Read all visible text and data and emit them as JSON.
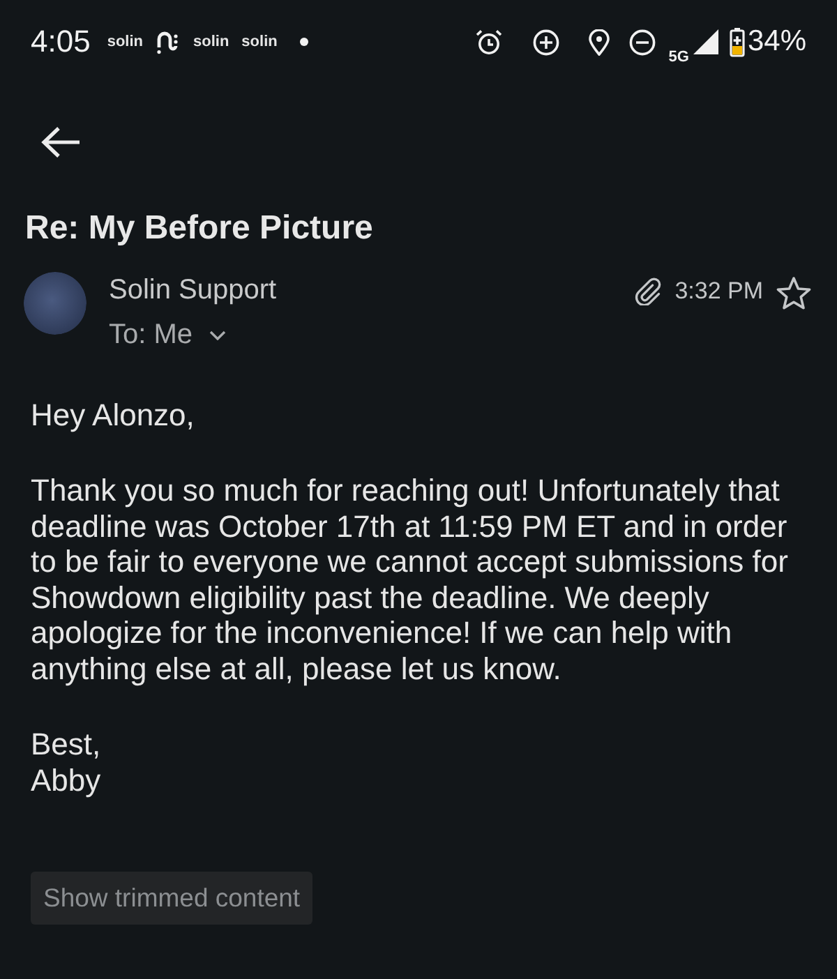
{
  "status_bar": {
    "time": "4:05",
    "notifications": [
      {
        "kind": "text",
        "label": "solin"
      },
      {
        "kind": "logo"
      },
      {
        "kind": "text",
        "label": "solin"
      },
      {
        "kind": "text",
        "label": "solin"
      },
      {
        "kind": "dot"
      }
    ],
    "network": "5G",
    "battery": "34%"
  },
  "subject": "Re: My Before Picture",
  "sender": {
    "name": "Solin Support",
    "recipient": "To: Me",
    "time": "3:32 PM",
    "has_attachment": true,
    "starred": false
  },
  "body": {
    "greeting": "Hey Alonzo,",
    "paragraphs": [
      "Thank you so much for reaching out! Unfortunately that deadline was October 17th at 11:59 PM ET and in order to be fair to everyone we cannot accept submissions for Showdown eligibility past the deadline. We deeply apologize for the inconvenience! If we can help with anything else at all, please let us know."
    ],
    "closing": [
      "Best,",
      "Abby"
    ]
  },
  "trimmed_button": "Show trimmed content"
}
